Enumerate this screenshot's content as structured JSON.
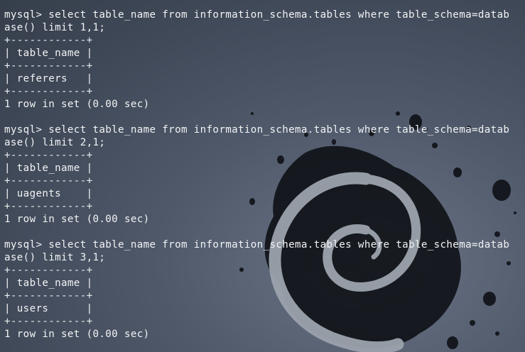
{
  "terminal": {
    "lines": [
      "mysql> select table_name from information_schema.tables where table_schema=datab",
      "ase() limit 1,1;",
      "+------------+",
      "| table_name |",
      "+------------+",
      "| referers   |",
      "+------------+",
      "1 row in set (0.00 sec)",
      "",
      "mysql> select table_name from information_schema.tables where table_schema=datab",
      "ase() limit 2,1;",
      "+------------+",
      "| table_name |",
      "+------------+",
      "| uagents    |",
      "+------------+",
      "1 row in set (0.00 sec)",
      "",
      "mysql> select table_name from information_schema.tables where table_schema=datab",
      "ase() limit 3,1;",
      "+------------+",
      "| table_name |",
      "+------------+",
      "| users      |",
      "+------------+",
      "1 row in set (0.00 sec)"
    ]
  },
  "colors": {
    "text": "#f2f3f5",
    "background": "#4f596a",
    "splash": "#101318",
    "swirl": "#9ca3ad"
  },
  "icons": {
    "wallpaper_logo": "debian-swirl-icon"
  }
}
